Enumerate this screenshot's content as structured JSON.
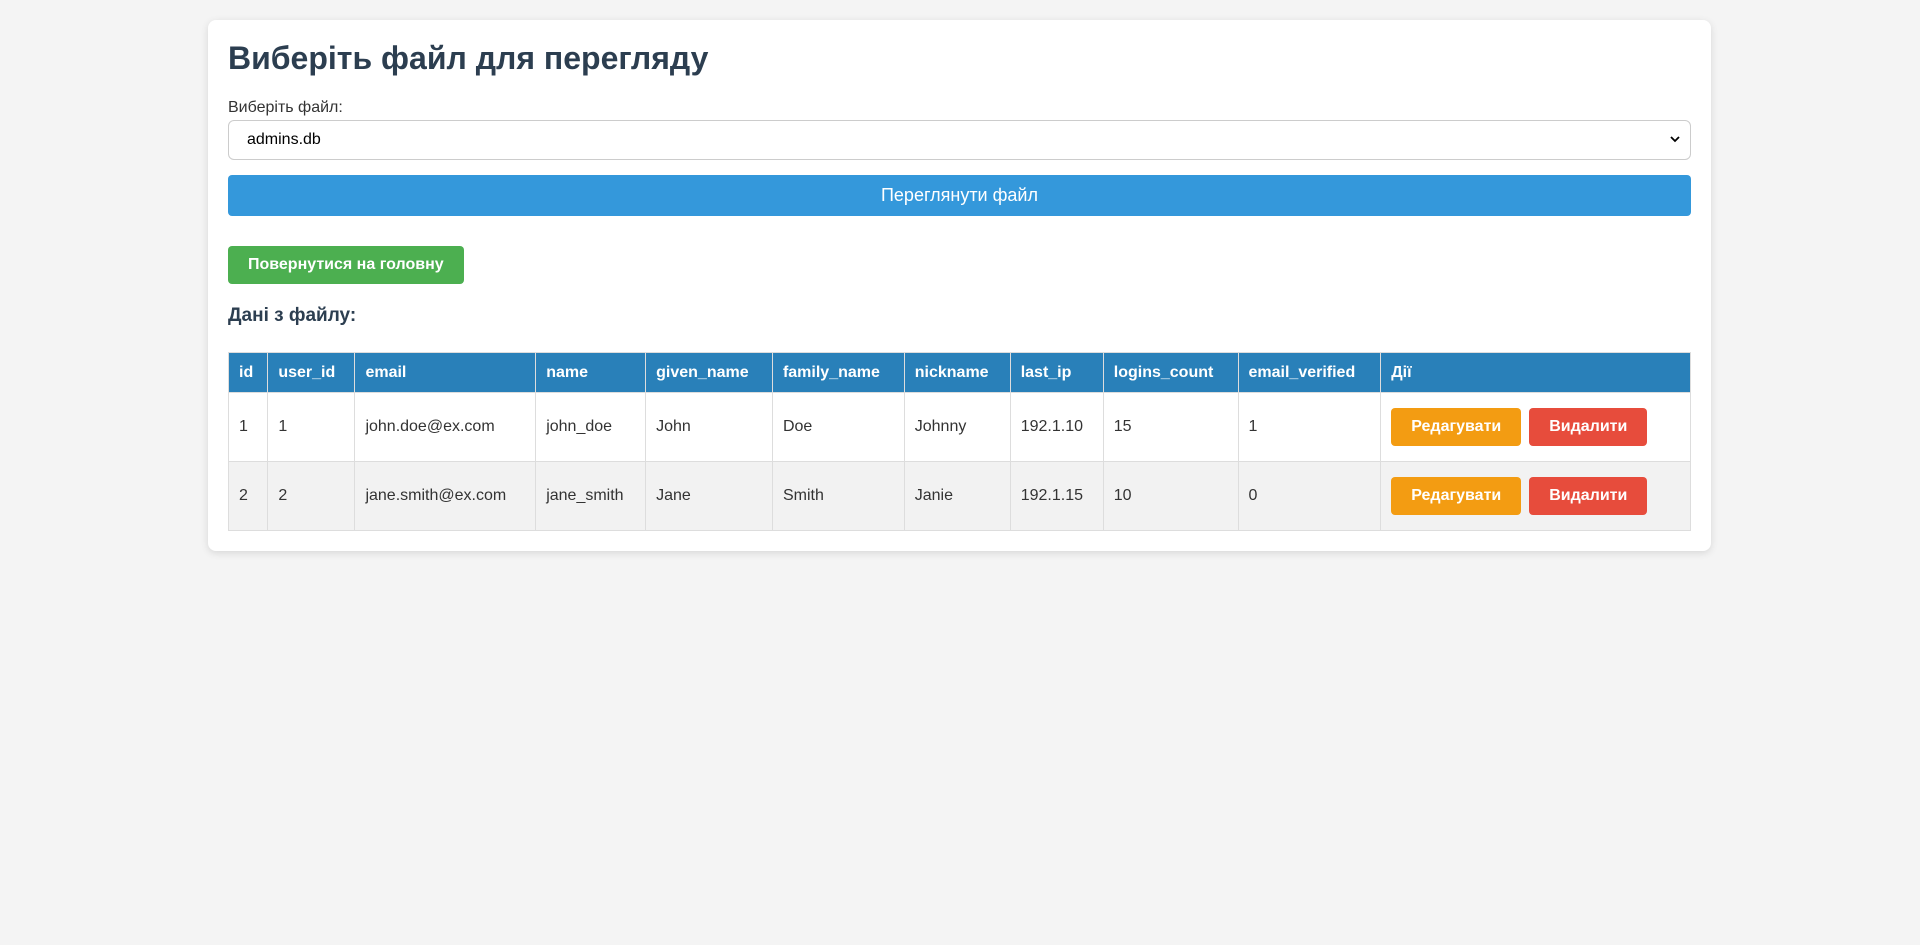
{
  "page": {
    "title": "Виберіть файл для перегляду",
    "file_label": "Виберіть файл:",
    "selected_file": "admins.db",
    "view_button": "Переглянути файл",
    "back_button": "Повернутися на головну",
    "data_heading": "Дані з файлу:"
  },
  "table": {
    "headers": [
      "id",
      "user_id",
      "email",
      "name",
      "given_name",
      "family_name",
      "nickname",
      "last_ip",
      "logins_count",
      "email_verified",
      "Дії"
    ],
    "rows": [
      [
        "1",
        "1",
        "john.doe@ex.com",
        "john_doe",
        "John",
        "Doe",
        "Johnny",
        "192.1.10",
        "15",
        "1"
      ],
      [
        "2",
        "2",
        "jane.smith@ex.com",
        "jane_smith",
        "Jane",
        "Smith",
        "Janie",
        "192.1.15",
        "10",
        "0"
      ]
    ],
    "edit_label": "Редагувати",
    "delete_label": "Видалити"
  },
  "colors": {
    "primary": "#3498db",
    "header": "#2980b9",
    "success": "#4caf50",
    "warning": "#f39c12",
    "danger": "#e74c3c"
  },
  "icons": {
    "select_arrow": "chevron-down-icon"
  }
}
